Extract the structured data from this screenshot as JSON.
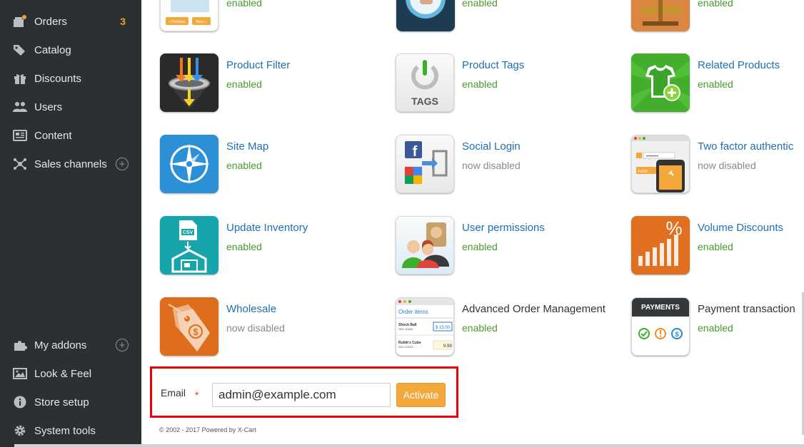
{
  "sidebar": {
    "top_items": [
      {
        "label": "Orders",
        "badge": "3",
        "icon": "orders-icon"
      },
      {
        "label": "Catalog",
        "icon": "tag-icon"
      },
      {
        "label": "Discounts",
        "icon": "gift-icon"
      },
      {
        "label": "Users",
        "icon": "users-icon"
      },
      {
        "label": "Content",
        "icon": "content-icon"
      },
      {
        "label": "Sales channels",
        "icon": "network-icon",
        "expand": "+"
      }
    ],
    "bottom_items": [
      {
        "label": "My addons",
        "icon": "puzzle-icon",
        "expand": "+"
      },
      {
        "label": "Look & Feel",
        "icon": "image-icon"
      },
      {
        "label": "Store setup",
        "icon": "info-icon"
      },
      {
        "label": "System tools",
        "icon": "gear-icon"
      }
    ]
  },
  "addons": {
    "row0": [
      {
        "status": "enabled"
      },
      {
        "status": "enabled"
      },
      {
        "status": "enabled"
      }
    ],
    "row1": [
      {
        "name": "Product Filter",
        "status": "enabled"
      },
      {
        "name": "Product Tags",
        "status": "enabled"
      },
      {
        "name": "Related Products",
        "status": "enabled"
      }
    ],
    "row2": [
      {
        "name": "Site Map",
        "status": "enabled"
      },
      {
        "name": "Social Login",
        "status": "now disabled"
      },
      {
        "name": "Two factor authentic",
        "status": "now disabled"
      }
    ],
    "row3": [
      {
        "name": "Update Inventory",
        "status": "enabled"
      },
      {
        "name": "User permissions",
        "status": "enabled"
      },
      {
        "name": "Volume Discounts",
        "status": "enabled"
      }
    ],
    "row4": [
      {
        "name": "Wholesale",
        "status": "now disabled"
      },
      {
        "name": "Advanced Order Management",
        "status": "enabled"
      },
      {
        "name": "Payment transaction",
        "status": "enabled"
      }
    ]
  },
  "tile_text": {
    "pager_prev": "« Previous",
    "pager_next": "Next »",
    "tags": "TAGS",
    "csv": "CSV",
    "percent": "%",
    "order_items": "Order items",
    "item1": "Shock Ball",
    "item1_sku": "SKU 10030",
    "item1_price": "$ 15.00",
    "item2": "Rubik's Cube",
    "item2_sku": "SKU 10023",
    "item2_price": "9.99",
    "payments": "PAYMENTS",
    "password_mask": "••••••••",
    "autor": "Autor"
  },
  "activation": {
    "email_label": "Email",
    "required_mark": "*",
    "email_value": "admin@example.com",
    "button_label": "Activate"
  },
  "footer": "© 2002 - 2017 Powered by X-Cart",
  "colors": {
    "sidebar_bg": "#2b3033",
    "link": "#1f6fb5",
    "enabled": "#4a9a2e",
    "disabled": "#8a8a8a",
    "activate_button": "#f2a83a",
    "highlight_border": "#e8000b",
    "badge": "#f0a030"
  }
}
